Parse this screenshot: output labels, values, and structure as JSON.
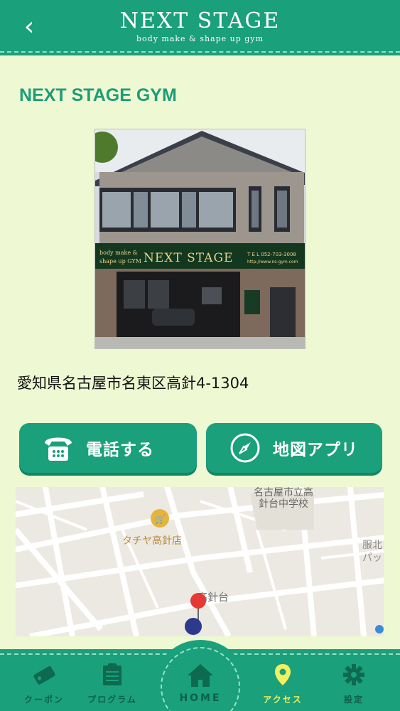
{
  "header": {
    "title": "NEXT STAGE",
    "subtitle": "body make & shape up gym"
  },
  "gym": {
    "name": "NEXT STAGE GYM",
    "address": "愛知県名古屋市名東区高針4-1304",
    "photo": {
      "sign_left_top": "body make &",
      "sign_left_bottom": "shape up GYM",
      "sign_main": "NEXT STAGE",
      "sign_tel": "T E L 052-703-3008",
      "sign_url": "http://www.ns-gym.com"
    }
  },
  "actions": {
    "call_label": "電話する",
    "map_label": "地図アプリ"
  },
  "map": {
    "labels": {
      "school_line1": "名古屋市立高",
      "school_line2": "針台中学校",
      "store": "タチヤ高針店",
      "district": "高針台",
      "edge_top": "服北",
      "edge_bottom": "パッ"
    }
  },
  "tabs": [
    {
      "label": "クーポン",
      "icon": "ticket-icon"
    },
    {
      "label": "プログラム",
      "icon": "clipboard-icon"
    },
    {
      "label": "HOME",
      "icon": "house-icon"
    },
    {
      "label": "アクセス",
      "icon": "map-pin-icon"
    },
    {
      "label": "設定",
      "icon": "gear-icon"
    }
  ],
  "colors": {
    "primary": "#1aa07b",
    "background": "#eef8d2",
    "active_tab": "#f3f060"
  }
}
